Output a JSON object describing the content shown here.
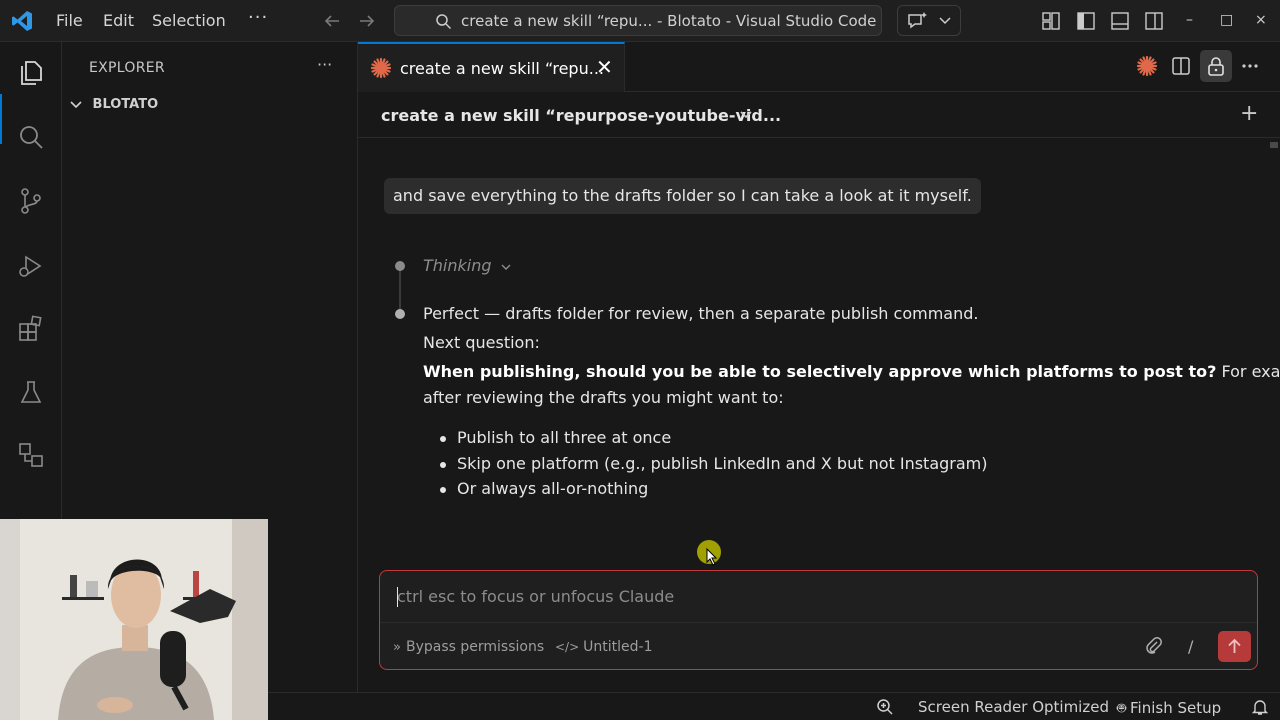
{
  "menu": {
    "file": "File",
    "edit": "Edit",
    "selection": "Selection",
    "more": "···"
  },
  "command_center": {
    "text": "create a new skill “repu... - Blotato - Visual Studio Code"
  },
  "window_controls": {
    "minimize": "–",
    "maximize": "□",
    "close": "×"
  },
  "sidebar": {
    "title": "EXPLORER",
    "more": "···",
    "folder": "BLOTATO"
  },
  "tab": {
    "label": "create a new skill “repu...",
    "close": "✕"
  },
  "editor": {
    "header_title": "create a new skill “repurpose-youtube-vid...",
    "plus": "+",
    "user_message": "and save everything to the drafts folder so I can take a look at it myself.",
    "thinking_label": "Thinking",
    "response_line1": "Perfect — drafts folder for review, then a separate publish command.",
    "response_line2": "Next question:",
    "question_bold": "When publishing, should you be able to selectively approve which platforms to post to?",
    "question_rest": " For example,",
    "response_line4": "after reviewing the drafts you might want to:",
    "bullets": [
      "Publish to all three at once",
      "Skip one platform (e.g., publish LinkedIn and X but not Instagram)",
      "Or always all-or-nothing"
    ]
  },
  "input": {
    "placeholder": "ctrl esc to focus or unfocus Claude",
    "bypass_label": "Bypass permissions",
    "file_label": "Untitled-1",
    "slash": "/"
  },
  "statusbar": {
    "screen_reader": "Screen Reader Optimized",
    "finish_setup": "Finish Setup"
  },
  "colors": {
    "accent": "#0078d4",
    "claude_orange": "#e0694a",
    "send_red": "#b73a3b"
  }
}
